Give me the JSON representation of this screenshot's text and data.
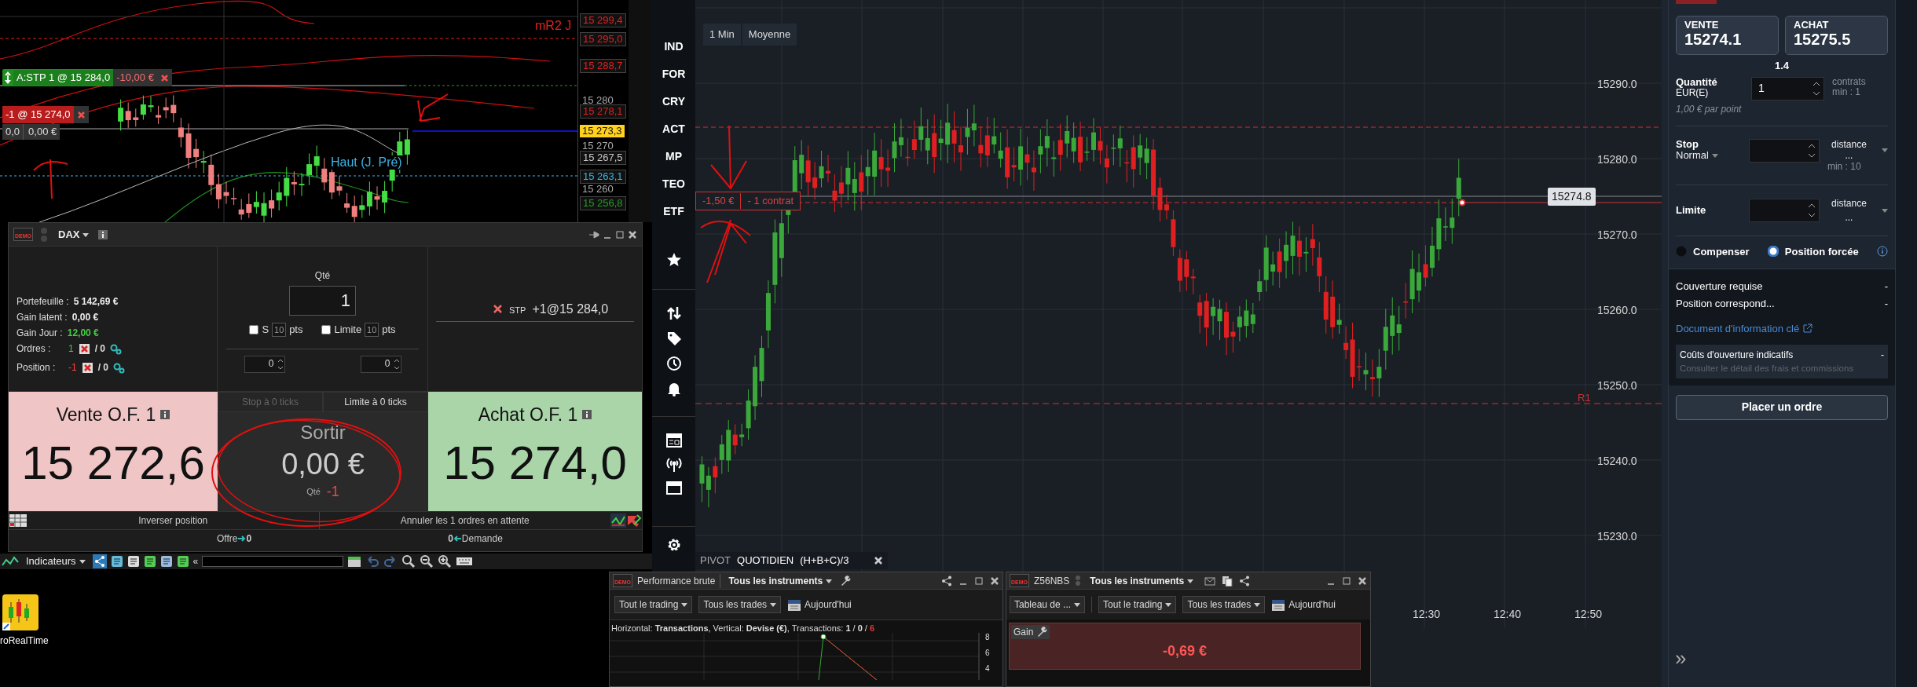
{
  "left_chart": {
    "price_labels": [
      {
        "text": "15 299,4",
        "kind": "tag",
        "color": "#e02020"
      },
      {
        "text": "15 295,0",
        "kind": "tag",
        "color": "#e02020"
      },
      {
        "text": "15 288,7",
        "kind": "tag",
        "color": "#e02020"
      },
      {
        "text": "15 280",
        "kind": "tick"
      },
      {
        "text": "15 278,1",
        "kind": "tag",
        "color": "#e02020"
      },
      {
        "text": "15 273,3",
        "kind": "current",
        "color": "#ffd21f"
      },
      {
        "text": "15 270",
        "kind": "tick"
      },
      {
        "text": "15 267,5",
        "kind": "tag",
        "color": "#c8c8c8"
      },
      {
        "text": "15 263,1",
        "kind": "tag",
        "color": "#3ab4e6"
      },
      {
        "text": "15 260",
        "kind": "tick"
      },
      {
        "text": "15 256,8",
        "kind": "tag",
        "color": "#2a9a2a"
      }
    ],
    "line_labels": [
      {
        "text": "mR2 J",
        "color": "#e02020"
      },
      {
        "text": "Haut (J. Pré)",
        "color": "#3ab4e6"
      }
    ],
    "stop_order": {
      "label": "A:STP  1 @ 15 284,0",
      "pnl": "-10,00 €"
    },
    "position": {
      "label": "-1 @ 15 274,0",
      "points": "0,0",
      "pnl": "0,00 €"
    }
  },
  "order_window": {
    "badge": "DEMO",
    "instrument": "DAX",
    "account": [
      {
        "label": "Portefeuille :",
        "value": "5 142,69 €",
        "kind": "plain"
      },
      {
        "label": "Gain latent :",
        "value": "0,00 €",
        "kind": "plain"
      },
      {
        "label": "Gain Jour :",
        "value": "12,00 €",
        "kind": "gain"
      }
    ],
    "orders": {
      "label": "Ordres :",
      "count": "1",
      "auto": "/ 0"
    },
    "position": {
      "label": "Position :",
      "count": "-1",
      "auto": "/ 0"
    },
    "quantity": {
      "label": "Qté",
      "value": "1"
    },
    "options": [
      {
        "label": "S",
        "checked": false,
        "value": "10",
        "unit": "pts"
      },
      {
        "label": "Limite",
        "checked": false,
        "value": "10",
        "unit": "pts"
      }
    ],
    "spinners": [
      "0",
      "0"
    ],
    "pending_order": {
      "type": "STP",
      "text": "+1@15 284,0"
    },
    "sell": {
      "label": "Vente O.F. 1",
      "price": "15 272,6"
    },
    "buy": {
      "label": "Achat O.F. 1",
      "price": "15 274,0"
    },
    "tick_buttons": [
      {
        "label": "Stop à 0 ticks",
        "disabled": true
      },
      {
        "label": "Limite à 0 ticks",
        "disabled": false
      }
    ],
    "exit": {
      "label": "Sortir",
      "amount": "0,00 €",
      "qty_label": "Qté",
      "qty": "-1"
    },
    "reverse_button": "Inverser position",
    "cancel_button": "Annuler les 1 ordres en attente",
    "offer": {
      "label": "Offre",
      "value": "0"
    },
    "demand": {
      "value": "0",
      "label": "Demande"
    }
  },
  "toolbar": {
    "indicators": "Indicateurs",
    "collapse": "«"
  },
  "desktop_icon": {
    "label": "roRealTime"
  },
  "sidebar": {
    "items": [
      {
        "label": "IND"
      },
      {
        "label": "FOR"
      },
      {
        "label": "CRY"
      },
      {
        "label": "ACT"
      },
      {
        "label": "MP"
      },
      {
        "label": "TEO"
      },
      {
        "label": "ETF"
      }
    ]
  },
  "chart": {
    "buttons": [
      "1 Min",
      "Moyenne"
    ],
    "price_ticks": [
      "15290.0",
      "15280.0",
      "15270.0",
      "15260.0",
      "15250.0",
      "15240.0",
      "15230.0"
    ],
    "time_ticks": [
      "12:30",
      "12:40",
      "12:50"
    ],
    "current_price": "15274.8",
    "position_tag": {
      "pnl": "-1,50 €",
      "size": "- 1 contrat"
    },
    "pivot_label": "R1",
    "pivot_bar": {
      "source": "PIVOT",
      "period": "QUOTIDIEN",
      "formula": "(H+B+C)/3"
    }
  },
  "ticket": {
    "sell": {
      "label": "VENTE",
      "price": "15274.1"
    },
    "buy": {
      "label": "ACHAT",
      "price": "15275.5"
    },
    "spread": "1.4",
    "quantity": {
      "label": "Quantité",
      "unit": "EUR(E)",
      "value": "1",
      "suffix": "contrats",
      "min": "min : 1",
      "note": "1,00 € par point"
    },
    "stop": {
      "label": "Stop",
      "type": "Normal",
      "mode": "distance ...",
      "min": "min : 10"
    },
    "limit": {
      "label": "Limite",
      "mode": "distance ..."
    },
    "radios": [
      {
        "label": "Compenser",
        "selected": false
      },
      {
        "label": "Position forcée",
        "selected": true
      }
    ],
    "summary": [
      {
        "label": "Couverture requise",
        "value": "-"
      },
      {
        "label": "Position correspond...",
        "value": "-"
      }
    ],
    "doc_link": "Document d'information clé",
    "costs": {
      "label": "Coûts d'ouverture indicatifs",
      "value": "-",
      "detail": "Consulter le détail des frais et commissions"
    },
    "submit": "Placer un ordre",
    "expand": "»"
  },
  "performance_window": {
    "badge": "DEMO",
    "title": "Performance brute",
    "scope": "Tous les instruments",
    "filters": [
      "Tout le trading",
      "Tous les trades"
    ],
    "date": "Aujourd'hui",
    "info": "Horizontal: **Transactions**, Vertical: **Devise (€)**, Transactions: **1** / **0** / ",
    "info_count": "6",
    "y_ticks": [
      "8",
      "6",
      "4"
    ]
  },
  "gain_window": {
    "badge": "DEMO",
    "title": "Z56NBS",
    "scope": "Tous les instruments",
    "view": "Tableau de ...",
    "filters": [
      "Tout le trading",
      "Tous les trades"
    ],
    "date": "Aujourd'hui",
    "gain_label": "Gain",
    "gain_value": "-0,69 €"
  }
}
